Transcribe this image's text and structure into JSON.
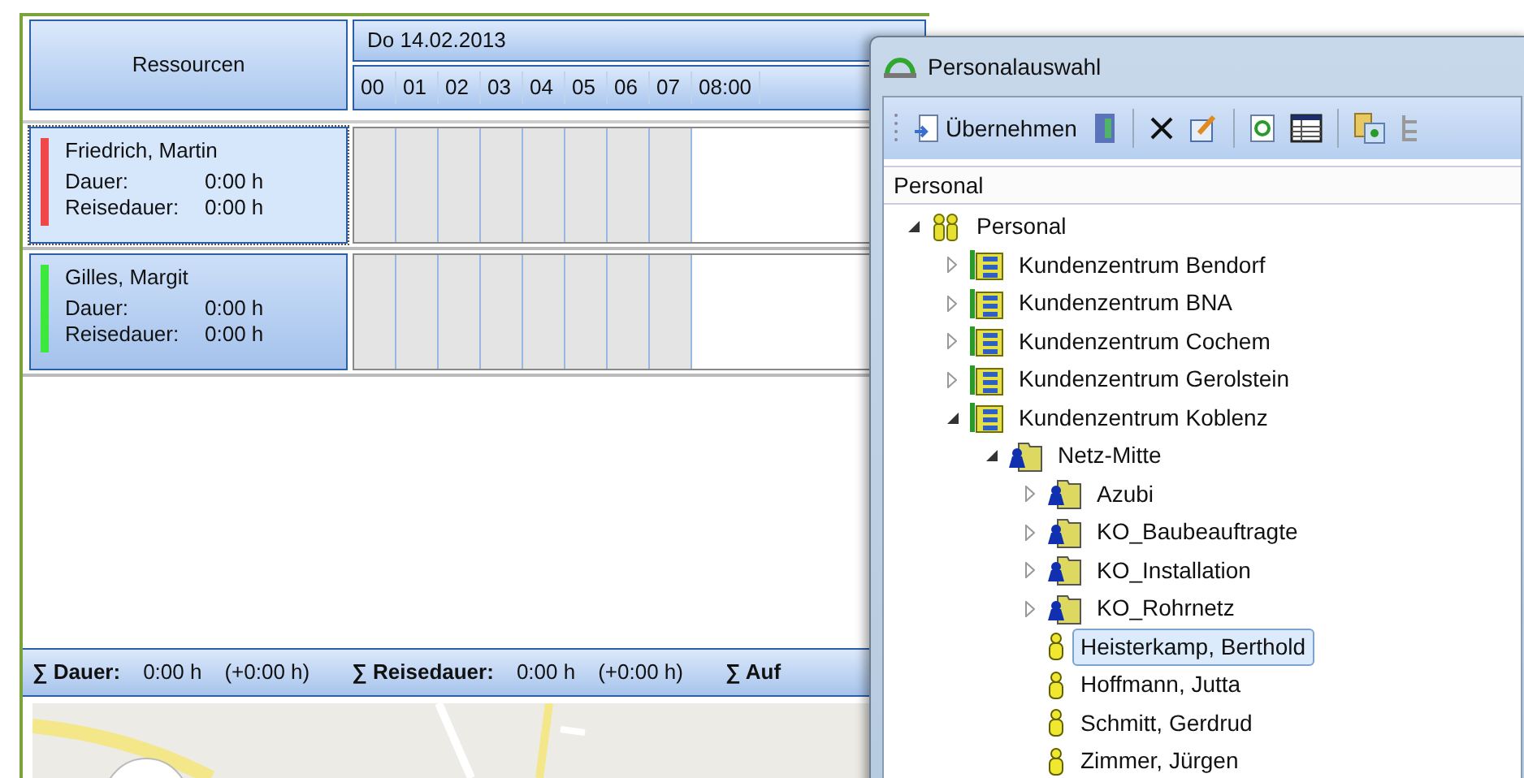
{
  "scheduler": {
    "resources_header": "Ressourcen",
    "date": "Do 14.02.2013",
    "hours": [
      "00",
      "01",
      "02",
      "03",
      "04",
      "05",
      "06",
      "07",
      "08:00"
    ],
    "resources": [
      {
        "name": "Friedrich, Martin",
        "color": "#f04848",
        "selected": true,
        "duration_label": "Dauer:",
        "duration": "0:00 h",
        "travel_label": "Reisedauer:",
        "travel": "0:00 h"
      },
      {
        "name": "Gilles, Margit",
        "color": "#3ce83c",
        "selected": false,
        "duration_label": "Dauer:",
        "duration": "0:00 h",
        "travel_label": "Reisedauer:",
        "travel": "0:00 h"
      }
    ]
  },
  "summary_bar": [
    {
      "label": "∑ Dauer:",
      "value": "0:00 h",
      "delta": "(+0:00 h)"
    },
    {
      "label": "∑ Reisedauer:",
      "value": "0:00 h",
      "delta": "(+0:00 h)"
    },
    {
      "label": "∑ Auf"
    }
  ],
  "dialog": {
    "title": "Personalauswahl",
    "toolbar": {
      "apply_button": "Übernehmen"
    },
    "column_header": "Personal",
    "tree": [
      {
        "label": "Personal",
        "kind": "root",
        "expanded": true,
        "selected": false,
        "children": [
          {
            "label": "Kundenzentrum Bendorf",
            "kind": "center",
            "expanded": false,
            "selected": false
          },
          {
            "label": "Kundenzentrum BNA",
            "kind": "center",
            "expanded": false,
            "selected": false
          },
          {
            "label": "Kundenzentrum Cochem",
            "kind": "center",
            "expanded": false,
            "selected": false
          },
          {
            "label": "Kundenzentrum Gerolstein",
            "kind": "center",
            "expanded": false,
            "selected": false
          },
          {
            "label": "Kundenzentrum Koblenz",
            "kind": "center",
            "expanded": true,
            "selected": false,
            "children": [
              {
                "label": "Netz-Mitte",
                "kind": "group",
                "expanded": true,
                "selected": false,
                "children": [
                  {
                    "label": "Azubi",
                    "kind": "group",
                    "expanded": false,
                    "selected": false
                  },
                  {
                    "label": "KO_Baubeauftragte",
                    "kind": "group",
                    "expanded": false,
                    "selected": false
                  },
                  {
                    "label": "KO_Installation",
                    "kind": "group",
                    "expanded": false,
                    "selected": false
                  },
                  {
                    "label": "KO_Rohrnetz",
                    "kind": "group",
                    "expanded": false,
                    "selected": false
                  },
                  {
                    "label": "Heisterkamp, Berthold",
                    "kind": "person",
                    "selected": true
                  },
                  {
                    "label": "Hoffmann, Jutta",
                    "kind": "person",
                    "selected": false
                  },
                  {
                    "label": "Schmitt, Gerdrud",
                    "kind": "person",
                    "selected": false
                  },
                  {
                    "label": "Zimmer, Jürgen",
                    "kind": "person",
                    "selected": false
                  }
                ]
              }
            ]
          }
        ]
      }
    ]
  }
}
